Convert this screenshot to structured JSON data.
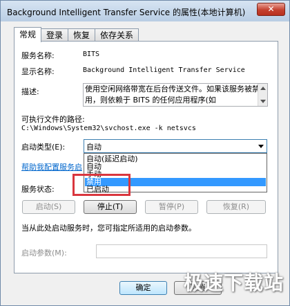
{
  "window": {
    "title": "Background Intelligent Transfer Service 的属性(本地计算机)",
    "close_glyph": "✕"
  },
  "tabs": [
    {
      "label": "常规",
      "active": true
    },
    {
      "label": "登录",
      "active": false
    },
    {
      "label": "恢复",
      "active": false
    },
    {
      "label": "依存关系",
      "active": false
    }
  ],
  "general": {
    "service_name_label": "服务名称:",
    "service_name_value": "BITS",
    "display_name_label": "显示名称:",
    "display_name_value": "Background Intelligent Transfer Service",
    "description_label": "描述:",
    "description_value": "使用空闲网络带宽在后台传送文件。如果该服务被禁用，则依赖于 BITS 的任何应用程序(如",
    "exe_path_label": "可执行文件的路径:",
    "exe_path_value": "C:\\Windows\\System32\\svchost.exe -k netsvcs",
    "startup_type_label": "启动类型(E):",
    "startup_type_value": "自动",
    "startup_options": [
      "自动(延迟启动)",
      "自动",
      "手动",
      "禁用",
      "已启动"
    ],
    "startup_selected_index": 3,
    "help_link": "帮助我配置服务启",
    "status_label": "服务状态:",
    "buttons": {
      "start": "启动(S)",
      "stop": "停止(T)",
      "pause": "暂停(P)",
      "resume": "恢复(R)"
    },
    "hint": "当从此处启动服务时，您可指定所适用的启动参数。",
    "start_params_label": "启动参数(M):",
    "start_params_value": ""
  },
  "footer": {
    "ok": "确定",
    "cancel": "取消"
  },
  "watermark": "极速下载站"
}
